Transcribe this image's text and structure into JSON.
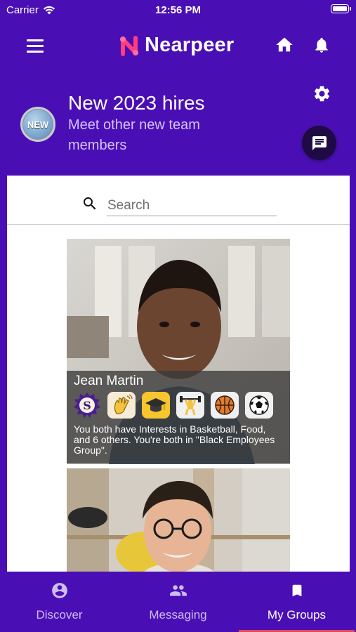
{
  "status_bar": {
    "carrier": "Carrier",
    "time": "12:56 PM"
  },
  "app_bar": {
    "logo_text": "Nearpeer",
    "accent_colors": [
      "#ff3d7f",
      "#ffffff"
    ]
  },
  "group": {
    "badge_text": "NEW",
    "title": "New 2023 hires",
    "subtitle": "Meet other new team members"
  },
  "search": {
    "placeholder": "Search",
    "value": ""
  },
  "people": [
    {
      "name": "Jean Martin",
      "badges": [
        "school-seal-icon",
        "waving-hand-icon",
        "graduation-cap-icon",
        "weightlifter-icon",
        "basketball-icon",
        "soccer-ball-icon"
      ],
      "description": "You both have Interests in Basketball, Food, and 6 others. You're both in \"Black Employees Group\"."
    },
    {
      "name": "",
      "badges": [],
      "description": ""
    }
  ],
  "tabs": [
    {
      "label": "Discover",
      "icon": "person-circle-icon",
      "active": false
    },
    {
      "label": "Messaging",
      "icon": "people-icon",
      "active": false
    },
    {
      "label": "My Groups",
      "icon": "bookmark-icon",
      "active": true
    }
  ],
  "colors": {
    "brand_purple": "#4a0fb4",
    "dark_fab": "#1f0a45",
    "active_tab_indicator": "#e04a5f"
  }
}
